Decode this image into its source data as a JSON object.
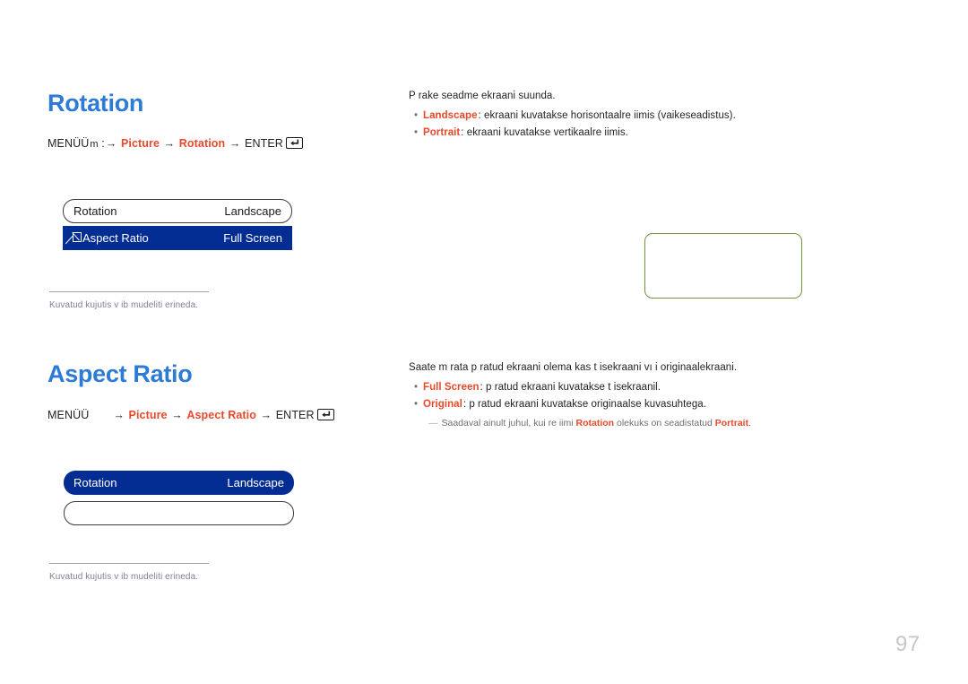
{
  "page": {
    "number": "97",
    "colors": {
      "heading_blue": "#2e7bd6",
      "accent_orange": "#e8492b",
      "osd_selected_blue": "#032d92",
      "green_border": "#6e9144",
      "footnote_gray": "#7e8296"
    }
  },
  "sections": [
    {
      "heading": "Rotation",
      "menu_path": {
        "prefix": "MENÜÜ",
        "menu_glyph": "m",
        "colon": ":",
        "steps": [
          "Picture",
          "Rotation"
        ],
        "enter_label": "ENTER",
        "enter_icon": "enter-key-icon",
        "arrow": "→"
      },
      "osd": {
        "rows": [
          {
            "label": "Rotation",
            "value": "Landscape",
            "selected": false,
            "has_glyph": false
          },
          {
            "label": "Aspect Ratio",
            "value": "Full Screen",
            "selected": true,
            "has_glyph": true
          }
        ]
      },
      "footnote": "Kuvatud kujutis v ib mudeliti erineda.",
      "body": {
        "lead": "P rake seadme ekraani suunda.",
        "bullets": [
          {
            "term": "Landscape",
            "text": ": ekraani kuvatakse horisontaalre iimis (vaikeseadistus)."
          },
          {
            "term": "Portrait",
            "text": ": ekraani kuvatakse vertikaalre iimis."
          }
        ],
        "subnote": null
      }
    },
    {
      "heading": "Aspect Ratio",
      "menu_path": {
        "prefix": "MENÜÜ",
        "menu_glyph": "",
        "colon": "",
        "steps": [
          "Picture",
          "Aspect Ratio"
        ],
        "enter_label": "ENTER",
        "enter_icon": "enter-key-icon",
        "arrow": "→"
      },
      "osd": {
        "rows": [
          {
            "label": "Rotation",
            "value": "Landscape",
            "selected": true,
            "has_glyph": false
          },
          {
            "label": "",
            "value": "",
            "selected": false,
            "has_glyph": false
          }
        ]
      },
      "footnote": "Kuvatud kujutis v ib mudeliti erineda.",
      "body": {
        "lead": "Saate m  rata p  ratud ekraani olema kas t isekraani vı i originaalekraani.",
        "bullets": [
          {
            "term": "Full Screen",
            "text": ": p  ratud ekraani kuvatakse t isekraanil."
          },
          {
            "term": "Original",
            "text": ": p  ratud ekraani kuvatakse originaalse kuvasuhtega."
          }
        ],
        "subnote": {
          "dash": "—",
          "before": "Saadaval ainult juhul, kui re iimi ",
          "accent1": "Rotation",
          "middle": " olekuks on seadistatud ",
          "accent2": "Portrait",
          "after": "."
        }
      }
    }
  ]
}
